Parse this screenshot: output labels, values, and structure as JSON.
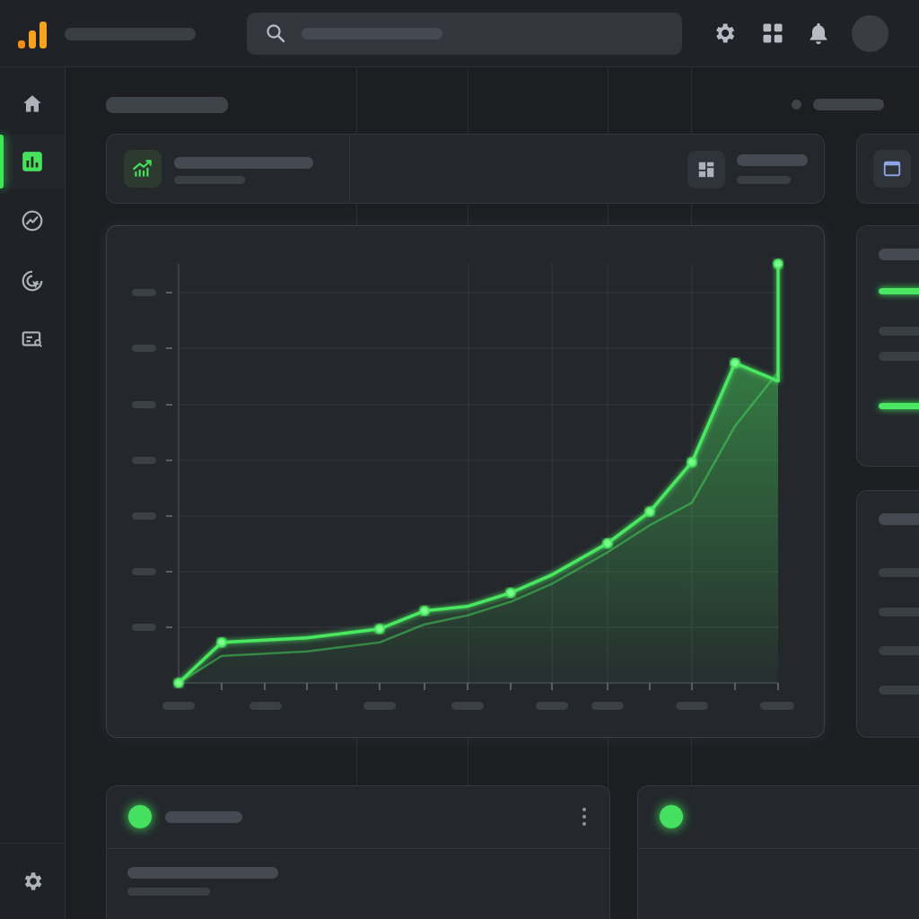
{
  "colors": {
    "accent_green": "#4ae860",
    "logo_orange": "#f6a21e",
    "logo_amber": "#f08c19",
    "background": "#1c1e22",
    "panel": "#24272c"
  },
  "header": {
    "logo_icon": "bar-chart-logo-icon",
    "search_icon": "search-icon",
    "icons": [
      "gear-icon",
      "grid-icon",
      "bell-icon"
    ],
    "avatar": "avatar"
  },
  "sidebar": {
    "items": [
      {
        "icon": "home-icon",
        "active": false
      },
      {
        "icon": "analytics-icon",
        "active": true
      },
      {
        "icon": "trend-icon",
        "active": false
      },
      {
        "icon": "target-click-icon",
        "active": false
      },
      {
        "icon": "report-icon",
        "active": false
      }
    ],
    "footer_icon": "gear-icon"
  },
  "chart_data": {
    "type": "line",
    "x": [
      0,
      1,
      2,
      3,
      4,
      5,
      6,
      7,
      8,
      9,
      10,
      11,
      12,
      13,
      14
    ],
    "series": [
      {
        "values": [
          0,
          0.9,
          1.0,
          1.2,
          1.6,
          1.7,
          2.0,
          2.4,
          3.1,
          3.8,
          4.9,
          7.1,
          6.7,
          9.3
        ]
      },
      {
        "values": [
          0,
          0.6,
          0.7,
          0.9,
          1.3,
          1.5,
          1.8,
          2.2,
          2.9,
          3.5,
          4.0,
          5.7,
          6.9
        ]
      }
    ],
    "ylim": [
      0,
      9.3
    ],
    "grid": true,
    "markers": true
  }
}
